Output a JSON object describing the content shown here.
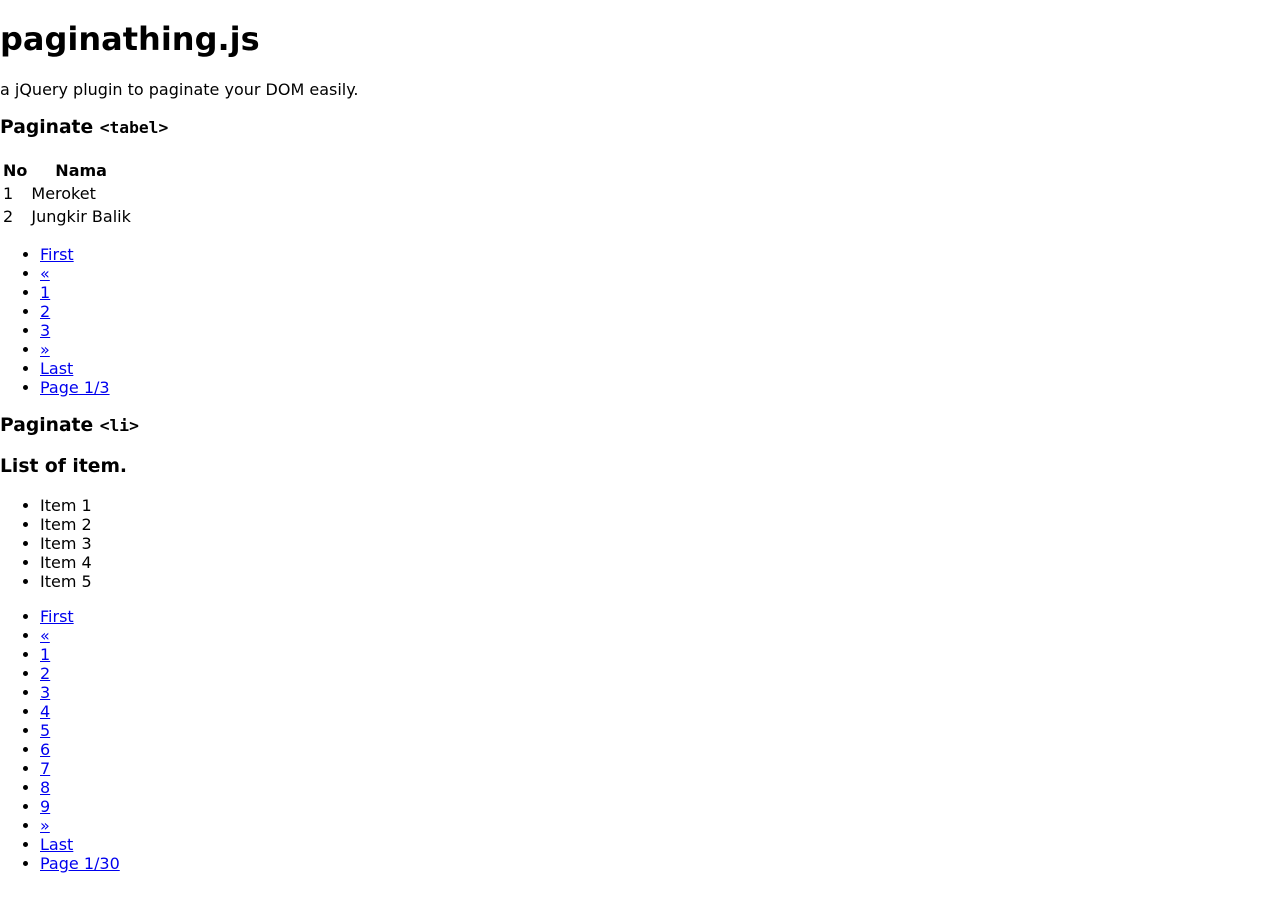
{
  "page": {
    "title": "paginathing.js",
    "tagline": "a jQuery plugin to paginate your DOM easily.",
    "link_color": "#0000EE",
    "text_color": "#000000",
    "background_color": "#ffffff"
  },
  "section_table": {
    "heading_text": "Paginate",
    "heading_code": "<tabel>",
    "table": {
      "columns": [
        "No",
        "Nama"
      ],
      "rows": [
        [
          "1",
          "Meroket"
        ],
        [
          "2",
          "Jungkir Balik"
        ]
      ]
    },
    "pagination": {
      "items": [
        {
          "label": "First",
          "name": "pagination-first"
        },
        {
          "label": "«",
          "name": "pagination-prev"
        },
        {
          "label": "1",
          "name": "pagination-page-1"
        },
        {
          "label": "2",
          "name": "pagination-page-2"
        },
        {
          "label": "3",
          "name": "pagination-page-3"
        },
        {
          "label": "»",
          "name": "pagination-next"
        },
        {
          "label": "Last",
          "name": "pagination-last"
        },
        {
          "label": "Page 1/3",
          "name": "pagination-status"
        }
      ]
    }
  },
  "section_list": {
    "heading_text": "Paginate",
    "heading_code": "<li>",
    "subheading": "List of item.",
    "items": [
      "Item 1",
      "Item 2",
      "Item 3",
      "Item 4",
      "Item 5"
    ],
    "pagination": {
      "items": [
        {
          "label": "First",
          "name": "pagination-first"
        },
        {
          "label": "«",
          "name": "pagination-prev"
        },
        {
          "label": "1",
          "name": "pagination-page-1"
        },
        {
          "label": "2",
          "name": "pagination-page-2"
        },
        {
          "label": "3",
          "name": "pagination-page-3"
        },
        {
          "label": "4",
          "name": "pagination-page-4"
        },
        {
          "label": "5",
          "name": "pagination-page-5"
        },
        {
          "label": "6",
          "name": "pagination-page-6"
        },
        {
          "label": "7",
          "name": "pagination-page-7"
        },
        {
          "label": "8",
          "name": "pagination-page-8"
        },
        {
          "label": "9",
          "name": "pagination-page-9"
        },
        {
          "label": "»",
          "name": "pagination-next"
        },
        {
          "label": "Last",
          "name": "pagination-last"
        },
        {
          "label": "Page 1/30",
          "name": "pagination-status"
        }
      ]
    }
  }
}
